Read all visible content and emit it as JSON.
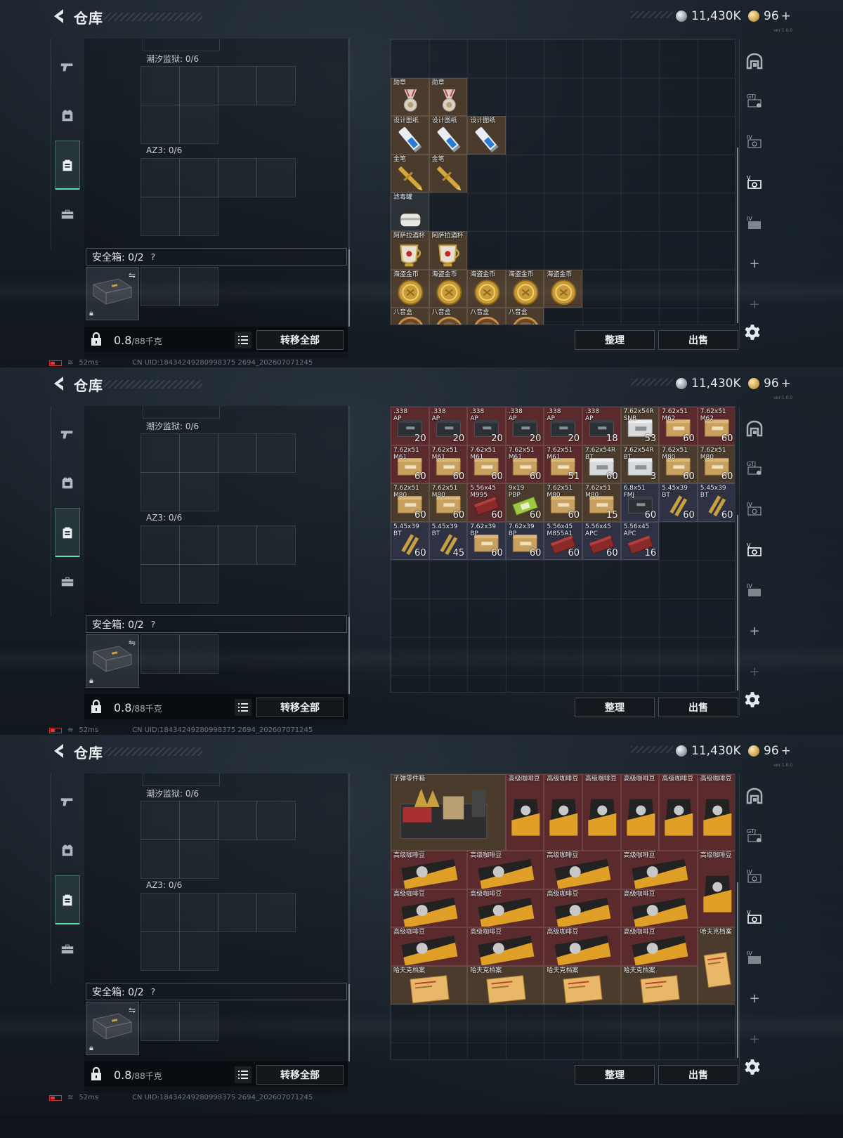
{
  "header": {
    "title": "仓库",
    "silver": "11,430K",
    "gold": "96",
    "gold_plus": "+",
    "version": "ver 1.0.0"
  },
  "backpack": {
    "tide_label": "潮汐监狱: 0/6",
    "az3_label": "AZ3: 0/6",
    "safe_box_label": "安全箱: 0/2",
    "help": "?",
    "weight_value": "0.8",
    "weight_max": "/88千克",
    "transfer_all": "转移全部"
  },
  "buttons": {
    "sort": "整理",
    "sell": "出售"
  },
  "status": {
    "ping": "52ms",
    "uid": "CN UID:18434249280998375 2694_202607071245"
  },
  "panels": [
    {
      "items": [
        {
          "name": "勋章",
          "row": 1,
          "col": 0,
          "w": 1,
          "h": 1,
          "bg": "#4a3b2c",
          "icon": "medal"
        },
        {
          "name": "勋章",
          "row": 1,
          "col": 1,
          "w": 1,
          "h": 1,
          "bg": "#4a3b2c",
          "icon": "medal"
        },
        {
          "name": "设计图纸",
          "row": 2,
          "col": 0,
          "w": 1,
          "h": 1,
          "bg": "#4a3b2c",
          "icon": "blueprint"
        },
        {
          "name": "设计图纸",
          "row": 2,
          "col": 1,
          "w": 1,
          "h": 1,
          "bg": "#4a3b2c",
          "icon": "blueprint"
        },
        {
          "name": "设计图纸",
          "row": 2,
          "col": 2,
          "w": 1,
          "h": 1,
          "bg": "#4a3b2c",
          "icon": "blueprint"
        },
        {
          "name": "金笔",
          "row": 3,
          "col": 0,
          "w": 1,
          "h": 1,
          "bg": "#4a3b2c",
          "icon": "pen"
        },
        {
          "name": "金笔",
          "row": 3,
          "col": 1,
          "w": 1,
          "h": 1,
          "bg": "#4a3b2c",
          "icon": "pen"
        },
        {
          "name": "滤毒罐",
          "row": 4,
          "col": 0,
          "w": 1,
          "h": 1,
          "bg": "#2c3238",
          "icon": "canister"
        },
        {
          "name": "阿萨拉酒杯",
          "row": 5,
          "col": 0,
          "w": 1,
          "h": 1,
          "bg": "#4a3b2c",
          "icon": "cup"
        },
        {
          "name": "阿萨拉酒杯",
          "row": 5,
          "col": 1,
          "w": 1,
          "h": 1,
          "bg": "#4a3b2c",
          "icon": "cup"
        },
        {
          "name": "海盗金币",
          "row": 6,
          "col": 0,
          "w": 1,
          "h": 1,
          "bg": "#4a3b2c",
          "icon": "coin"
        },
        {
          "name": "海盗金币",
          "row": 6,
          "col": 1,
          "w": 1,
          "h": 1,
          "bg": "#4a3b2c",
          "icon": "coin"
        },
        {
          "name": "海盗金币",
          "row": 6,
          "col": 2,
          "w": 1,
          "h": 1,
          "bg": "#4a3b2c",
          "icon": "coin"
        },
        {
          "name": "海盗金币",
          "row": 6,
          "col": 3,
          "w": 1,
          "h": 1,
          "bg": "#4a3b2c",
          "icon": "coin"
        },
        {
          "name": "海盗金币",
          "row": 6,
          "col": 4,
          "w": 1,
          "h": 1,
          "bg": "#4a3b2c",
          "icon": "coin"
        },
        {
          "name": "八音盒",
          "row": 7,
          "col": 0,
          "w": 1,
          "h": 1,
          "bg": "#4a3b2c",
          "icon": "musicbox"
        },
        {
          "name": "八音盒",
          "row": 7,
          "col": 1,
          "w": 1,
          "h": 1,
          "bg": "#4a3b2c",
          "icon": "musicbox"
        },
        {
          "name": "八音盒",
          "row": 7,
          "col": 2,
          "w": 1,
          "h": 1,
          "bg": "#4a3b2c",
          "icon": "musicbox"
        },
        {
          "name": "八音盒",
          "row": 7,
          "col": 3,
          "w": 1,
          "h": 1,
          "bg": "#4a3b2c",
          "icon": "musicbox"
        }
      ]
    },
    {
      "items": [
        {
          "name": ".338\nAP",
          "count": "20",
          "row": 0,
          "col": 0,
          "w": 1,
          "h": 1,
          "bg": "#5a2a2c",
          "icon": "ammobox-dark"
        },
        {
          "name": ".338\nAP",
          "count": "20",
          "row": 0,
          "col": 1,
          "w": 1,
          "h": 1,
          "bg": "#5a2a2c",
          "icon": "ammobox-dark"
        },
        {
          "name": ".338\nAP",
          "count": "20",
          "row": 0,
          "col": 2,
          "w": 1,
          "h": 1,
          "bg": "#5a2a2c",
          "icon": "ammobox-dark"
        },
        {
          "name": ".338\nAP",
          "count": "20",
          "row": 0,
          "col": 3,
          "w": 1,
          "h": 1,
          "bg": "#5a2a2c",
          "icon": "ammobox-dark"
        },
        {
          "name": ".338\nAP",
          "count": "20",
          "row": 0,
          "col": 4,
          "w": 1,
          "h": 1,
          "bg": "#5a2a2c",
          "icon": "ammobox-dark"
        },
        {
          "name": ".338\nAP",
          "count": "18",
          "row": 0,
          "col": 5,
          "w": 1,
          "h": 1,
          "bg": "#5a2a2c",
          "icon": "ammobox-dark"
        },
        {
          "name": "7.62x54R\nSNB",
          "count": "53",
          "row": 0,
          "col": 6,
          "w": 1,
          "h": 1,
          "bg": "#4a3b2c",
          "icon": "ammobox-white"
        },
        {
          "name": "7.62x51\nM62",
          "count": "60",
          "row": 0,
          "col": 7,
          "w": 1,
          "h": 1,
          "bg": "#5a2a2c",
          "icon": "ammobox-tan"
        },
        {
          "name": "7.62x51\nM62",
          "count": "60",
          "row": 0,
          "col": 8,
          "w": 1,
          "h": 1,
          "bg": "#5a2a2c",
          "icon": "ammobox-tan"
        },
        {
          "name": "7.62x51\nM61",
          "count": "60",
          "row": 1,
          "col": 0,
          "w": 1,
          "h": 1,
          "bg": "#5a2a2c",
          "icon": "ammobox-tan"
        },
        {
          "name": "7.62x51\nM61",
          "count": "60",
          "row": 1,
          "col": 1,
          "w": 1,
          "h": 1,
          "bg": "#5a2a2c",
          "icon": "ammobox-tan"
        },
        {
          "name": "7.62x51\nM61",
          "count": "60",
          "row": 1,
          "col": 2,
          "w": 1,
          "h": 1,
          "bg": "#5a2a2c",
          "icon": "ammobox-tan"
        },
        {
          "name": "7.62x51\nM61",
          "count": "60",
          "row": 1,
          "col": 3,
          "w": 1,
          "h": 1,
          "bg": "#5a2a2c",
          "icon": "ammobox-tan"
        },
        {
          "name": "7.62x51\nM61",
          "count": "51",
          "row": 1,
          "col": 4,
          "w": 1,
          "h": 1,
          "bg": "#5a2a2c",
          "icon": "ammobox-tan"
        },
        {
          "name": "7.62x54R\nBT",
          "count": "60",
          "row": 1,
          "col": 5,
          "w": 1,
          "h": 1,
          "bg": "#4a3b2c",
          "icon": "ammobox-white"
        },
        {
          "name": "7.62x54R\nBT",
          "count": "3",
          "row": 1,
          "col": 6,
          "w": 1,
          "h": 1,
          "bg": "#4a3b2c",
          "icon": "ammobox-white"
        },
        {
          "name": "7.62x51\nM80",
          "count": "60",
          "row": 1,
          "col": 7,
          "w": 1,
          "h": 1,
          "bg": "#4a3b2c",
          "icon": "ammobox-tan"
        },
        {
          "name": "7.62x51\nM80",
          "count": "60",
          "row": 1,
          "col": 8,
          "w": 1,
          "h": 1,
          "bg": "#4a3b2c",
          "icon": "ammobox-tan"
        },
        {
          "name": "7.62x51\nM80",
          "count": "60",
          "row": 2,
          "col": 0,
          "w": 1,
          "h": 1,
          "bg": "#4a3b2c",
          "icon": "ammobox-tan"
        },
        {
          "name": "7.62x51\nM80",
          "count": "60",
          "row": 2,
          "col": 1,
          "w": 1,
          "h": 1,
          "bg": "#4a3b2c",
          "icon": "ammobox-tan"
        },
        {
          "name": "5.56x45\nM995",
          "count": "60",
          "row": 2,
          "col": 2,
          "w": 1,
          "h": 1,
          "bg": "#5a2a2c",
          "icon": "ammobox-red"
        },
        {
          "name": "9x19\nPBP",
          "count": "60",
          "row": 2,
          "col": 3,
          "w": 1,
          "h": 1,
          "bg": "#4a3b2c",
          "icon": "ammobox-green"
        },
        {
          "name": "7.62x51\nM80",
          "count": "60",
          "row": 2,
          "col": 4,
          "w": 1,
          "h": 1,
          "bg": "#4a3b2c",
          "icon": "ammobox-tan"
        },
        {
          "name": "7.62x51\nM80",
          "count": "15",
          "row": 2,
          "col": 5,
          "w": 1,
          "h": 1,
          "bg": "#4a3b2c",
          "icon": "ammobox-tan"
        },
        {
          "name": "6.8x51\nFMJ",
          "count": "60",
          "row": 2,
          "col": 6,
          "w": 1,
          "h": 1,
          "bg": "#2e3244",
          "icon": "ammobox-dark"
        },
        {
          "name": "5.45x39\nBT",
          "count": "60",
          "row": 2,
          "col": 7,
          "w": 1,
          "h": 1,
          "bg": "#2e3244",
          "icon": "bullets"
        },
        {
          "name": "5.45x39\nBT",
          "count": "60",
          "row": 2,
          "col": 8,
          "w": 1,
          "h": 1,
          "bg": "#2e3244",
          "icon": "bullets"
        },
        {
          "name": "5.45x39\nBT",
          "count": "60",
          "row": 3,
          "col": 0,
          "w": 1,
          "h": 1,
          "bg": "#2e3244",
          "icon": "bullets"
        },
        {
          "name": "5.45x39\nBT",
          "count": "45",
          "row": 3,
          "col": 1,
          "w": 1,
          "h": 1,
          "bg": "#2e3244",
          "icon": "bullets"
        },
        {
          "name": "7.62x39\nBP",
          "count": "60",
          "row": 3,
          "col": 2,
          "w": 1,
          "h": 1,
          "bg": "#2e3244",
          "icon": "ammobox-tan"
        },
        {
          "name": "7.62x39\nBP",
          "count": "60",
          "row": 3,
          "col": 3,
          "w": 1,
          "h": 1,
          "bg": "#2e3244",
          "icon": "ammobox-tan"
        },
        {
          "name": "5.56x45\nM855A1",
          "count": "60",
          "row": 3,
          "col": 4,
          "w": 1,
          "h": 1,
          "bg": "#2e3244",
          "icon": "ammobox-red"
        },
        {
          "name": "5.56x45\nAPC",
          "count": "60",
          "row": 3,
          "col": 5,
          "w": 1,
          "h": 1,
          "bg": "#2e3244",
          "icon": "ammobox-red"
        },
        {
          "name": "5.56x45\nAPC",
          "count": "16",
          "row": 3,
          "col": 6,
          "w": 1,
          "h": 1,
          "bg": "#2e3244",
          "icon": "ammobox-red"
        }
      ]
    },
    {
      "items": [
        {
          "name": "子弹零件箱",
          "row": 0,
          "col": 0,
          "w": 3,
          "h": 2,
          "bg": "#4a3b2c",
          "icon": "partsbox"
        },
        {
          "name": "高级咖啡豆",
          "row": 0,
          "col": 3,
          "w": 1,
          "h": 2,
          "bg": "#5a2a2c",
          "icon": "coffee-bag"
        },
        {
          "name": "高级咖啡豆",
          "row": 0,
          "col": 4,
          "w": 1,
          "h": 2,
          "bg": "#5a2a2c",
          "icon": "coffee-bag"
        },
        {
          "name": "高级咖啡豆",
          "row": 0,
          "col": 5,
          "w": 1,
          "h": 2,
          "bg": "#5a2a2c",
          "icon": "coffee-bag"
        },
        {
          "name": "高级咖啡豆",
          "row": 0,
          "col": 6,
          "w": 1,
          "h": 2,
          "bg": "#5a2a2c",
          "icon": "coffee-bag"
        },
        {
          "name": "高级咖啡豆",
          "row": 0,
          "col": 7,
          "w": 1,
          "h": 2,
          "bg": "#5a2a2c",
          "icon": "coffee-bag"
        },
        {
          "name": "高级咖啡豆",
          "row": 0,
          "col": 8,
          "w": 1,
          "h": 2,
          "bg": "#5a2a2c",
          "icon": "coffee-bag"
        },
        {
          "name": "高级咖啡豆",
          "row": 2,
          "col": 0,
          "w": 2,
          "h": 1,
          "bg": "#5a2a2c",
          "icon": "coffee-flat"
        },
        {
          "name": "高级咖啡豆",
          "row": 2,
          "col": 2,
          "w": 2,
          "h": 1,
          "bg": "#5a2a2c",
          "icon": "coffee-flat"
        },
        {
          "name": "高级咖啡豆",
          "row": 2,
          "col": 4,
          "w": 2,
          "h": 1,
          "bg": "#5a2a2c",
          "icon": "coffee-flat"
        },
        {
          "name": "高级咖啡豆",
          "row": 2,
          "col": 6,
          "w": 2,
          "h": 1,
          "bg": "#5a2a2c",
          "icon": "coffee-flat"
        },
        {
          "name": "高级咖啡豆",
          "row": 2,
          "col": 8,
          "w": 1,
          "h": 2,
          "bg": "#5a2a2c",
          "icon": "coffee-bag"
        },
        {
          "name": "高级咖啡豆",
          "row": 3,
          "col": 0,
          "w": 2,
          "h": 1,
          "bg": "#5a2a2c",
          "icon": "coffee-flat"
        },
        {
          "name": "高级咖啡豆",
          "row": 3,
          "col": 2,
          "w": 2,
          "h": 1,
          "bg": "#5a2a2c",
          "icon": "coffee-flat"
        },
        {
          "name": "高级咖啡豆",
          "row": 3,
          "col": 4,
          "w": 2,
          "h": 1,
          "bg": "#5a2a2c",
          "icon": "coffee-flat"
        },
        {
          "name": "高级咖啡豆",
          "row": 3,
          "col": 6,
          "w": 2,
          "h": 1,
          "bg": "#5a2a2c",
          "icon": "coffee-flat"
        },
        {
          "name": "高级咖啡豆",
          "row": 4,
          "col": 0,
          "w": 2,
          "h": 1,
          "bg": "#5a2a2c",
          "icon": "coffee-flat"
        },
        {
          "name": "高级咖啡豆",
          "row": 4,
          "col": 2,
          "w": 2,
          "h": 1,
          "bg": "#5a2a2c",
          "icon": "coffee-flat"
        },
        {
          "name": "高级咖啡豆",
          "row": 4,
          "col": 4,
          "w": 2,
          "h": 1,
          "bg": "#5a2a2c",
          "icon": "coffee-flat"
        },
        {
          "name": "高级咖啡豆",
          "row": 4,
          "col": 6,
          "w": 2,
          "h": 1,
          "bg": "#5a2a2c",
          "icon": "coffee-flat"
        },
        {
          "name": "哈夫克档案",
          "row": 4,
          "col": 8,
          "w": 1,
          "h": 2,
          "bg": "#4a3b2c",
          "icon": "files"
        },
        {
          "name": "哈夫克档案",
          "row": 5,
          "col": 0,
          "w": 2,
          "h": 1,
          "bg": "#4a3b2c",
          "icon": "files-flat"
        },
        {
          "name": "哈夫克档案",
          "row": 5,
          "col": 2,
          "w": 2,
          "h": 1,
          "bg": "#4a3b2c",
          "icon": "files-flat"
        },
        {
          "name": "哈夫克档案",
          "row": 5,
          "col": 4,
          "w": 2,
          "h": 1,
          "bg": "#4a3b2c",
          "icon": "files-flat"
        },
        {
          "name": "哈夫克档案",
          "row": 5,
          "col": 6,
          "w": 2,
          "h": 1,
          "bg": "#4a3b2c",
          "icon": "files-flat"
        }
      ]
    }
  ]
}
